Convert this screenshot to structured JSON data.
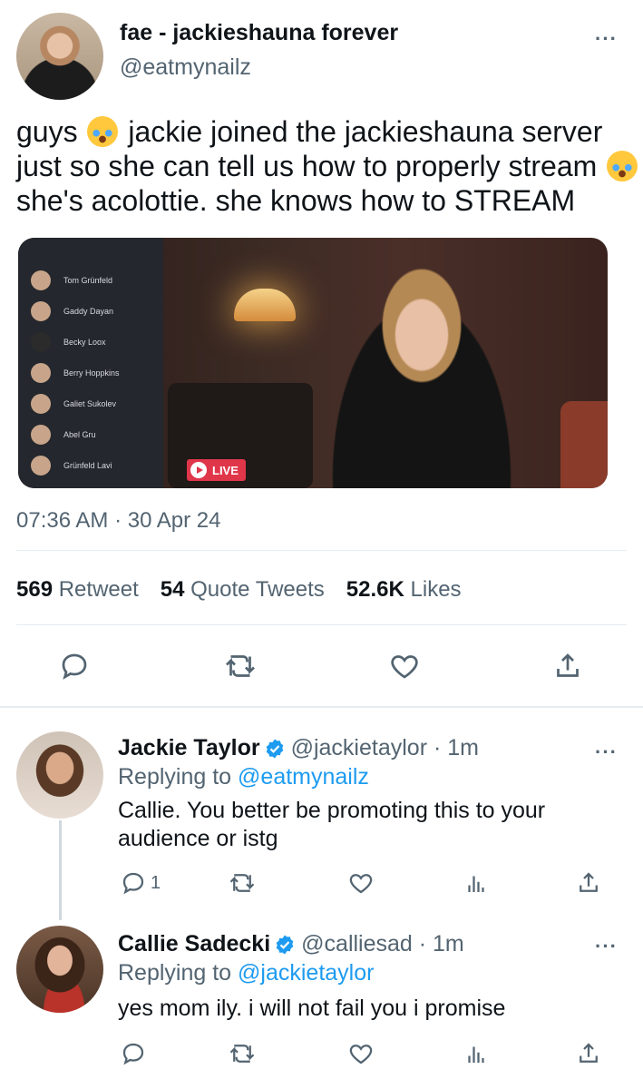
{
  "main_tweet": {
    "display_name": "fae - jackieshauna forever",
    "handle": "@eatmynailz",
    "text_part1": "guys ",
    "text_part2": " jackie joined the jackieshauna server just so she can tell us how to properly stream ",
    "text_part3": " she's acolottie. she knows how to STREAM",
    "emoji_name": "loudly-crying-face",
    "media": {
      "sidebar_friends": [
        "Tom Grünfeld",
        "Gaddy Dayan",
        "Becky Loox",
        "Berry Hoppkins",
        "Galiet Sukolev",
        "Abel Gru",
        "Grünfeld Lavi"
      ],
      "live_label": "LIVE"
    },
    "timestamp": "07:36 AM · 30 Apr 24",
    "stats": {
      "retweets_count": "569",
      "retweets_label": "Retweet",
      "quotes_count": "54",
      "quotes_label": "Quote Tweets",
      "likes_count": "52.6K",
      "likes_label": "Likes"
    }
  },
  "replies": [
    {
      "display_name": "Jackie Taylor",
      "handle_time": "@jackietaylor · 1m",
      "replying_prefix": "Replying to ",
      "replying_to": "@eatmynailz",
      "text": "Callie. You better be promoting this to your audience or istg",
      "reply_count": "1"
    },
    {
      "display_name": "Callie Sadecki",
      "handle_time": "@calliesad · 1m",
      "replying_prefix": "Replying to ",
      "replying_to": "@jackietaylor",
      "text": "yes mom ily. i will not fail you i promise",
      "reply_count": ""
    }
  ],
  "more_label": "···",
  "colors": {
    "text": "#0f1419",
    "secondary": "#536471",
    "link": "#1d9bf0",
    "divider": "#e6ecf0"
  }
}
